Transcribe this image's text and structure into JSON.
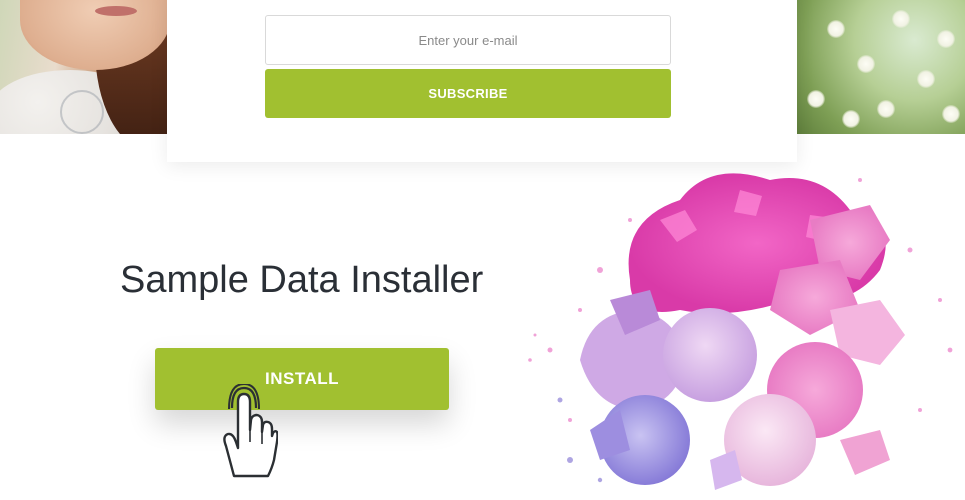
{
  "subscribe": {
    "email_placeholder": "Enter your e-mail",
    "button_label": "SUBSCRIBE"
  },
  "installer": {
    "title": "Sample Data Installer",
    "button_label": "INSTALL"
  },
  "colors": {
    "accent": "#a1c030",
    "title_text": "#2a2f36"
  },
  "icons": {
    "cursor": "hand-pointer-icon"
  }
}
